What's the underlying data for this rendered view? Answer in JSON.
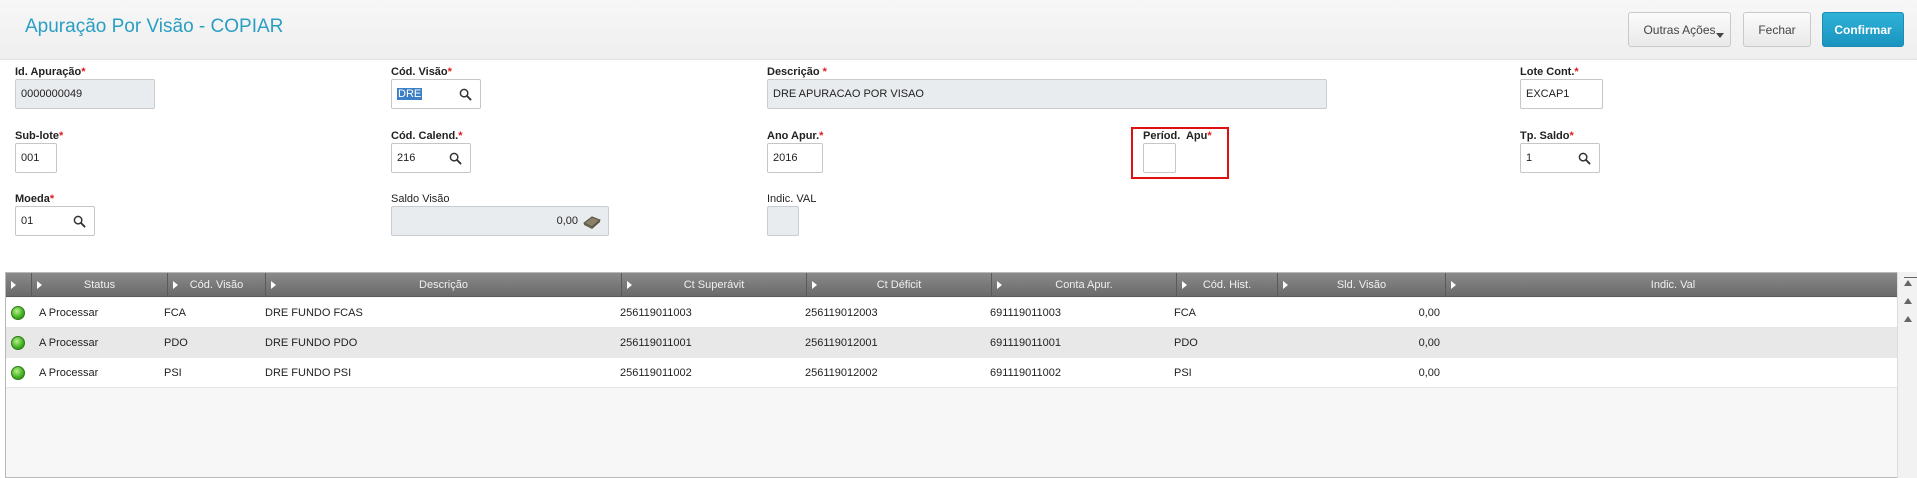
{
  "header": {
    "title": "Apuração Por Visão - COPIAR",
    "buttons": {
      "outras_acoes": "Outras Ações",
      "fechar": "Fechar",
      "confirmar": "Confirmar"
    }
  },
  "form": {
    "id_apuracao": {
      "label": "Id. Apuração",
      "value": "0000000049"
    },
    "cod_visao": {
      "label": "Cód. Visão",
      "value": "DRE"
    },
    "descricao": {
      "label": "Descrição ",
      "value": "DRE APURACAO POR VISAO"
    },
    "lote_cont": {
      "label": "Lote Cont.",
      "value": "EXCAP1"
    },
    "sub_lote": {
      "label": "Sub-lote",
      "value": "001"
    },
    "cod_calend": {
      "label": "Cód. Calend.",
      "value": "216"
    },
    "ano_apur": {
      "label": "Ano Apur.",
      "value": "2016"
    },
    "period_apu": {
      "label": "Períod.  Apu",
      "value": ""
    },
    "tp_saldo": {
      "label": "Tp. Saldo",
      "value": "1"
    },
    "moeda": {
      "label": "Moeda",
      "value": "01"
    },
    "saldo_visao": {
      "label": "Saldo Visão",
      "value": "0,00"
    },
    "indic_val": {
      "label": "Indic. VAL",
      "value": ""
    },
    "required_mark": "*"
  },
  "grid": {
    "columns": [
      "Status",
      "Cód. Visão",
      "Descrição",
      "Ct Superávit",
      "Ct Déficit",
      "Conta Apur.",
      "Cód. Hist.",
      "Sld. Visão",
      "Indic. Val"
    ],
    "rows": [
      {
        "status": "A Processar",
        "cod_visao": "FCA",
        "descricao": "DRE FUNDO FCAS",
        "ct_superavit": "256119011003",
        "ct_deficit": "256119012003",
        "conta_apur": "691119011003",
        "cod_hist": "FCA",
        "sld_visao": "0,00",
        "indic_val": ""
      },
      {
        "status": "A Processar",
        "cod_visao": "PDO",
        "descricao": "DRE FUNDO PDO",
        "ct_superavit": "256119011001",
        "ct_deficit": "256119012001",
        "conta_apur": "691119011001",
        "cod_hist": "PDO",
        "sld_visao": "0,00",
        "indic_val": ""
      },
      {
        "status": "A Processar",
        "cod_visao": "PSI",
        "descricao": "DRE FUNDO PSI",
        "ct_superavit": "256119011002",
        "ct_deficit": "256119012002",
        "conta_apur": "691119011002",
        "cod_hist": "PSI",
        "sld_visao": "0,00",
        "indic_val": ""
      }
    ]
  },
  "icons": {
    "search": "search-icon",
    "calculator": "calculator-icon",
    "status": "green-status-dot-icon"
  },
  "colors": {
    "title": "#2a9fc4",
    "confirm": "#1a94bf",
    "required": "#e01b1b",
    "highlight": "#e01010",
    "status_ok": "#3fae1e"
  }
}
